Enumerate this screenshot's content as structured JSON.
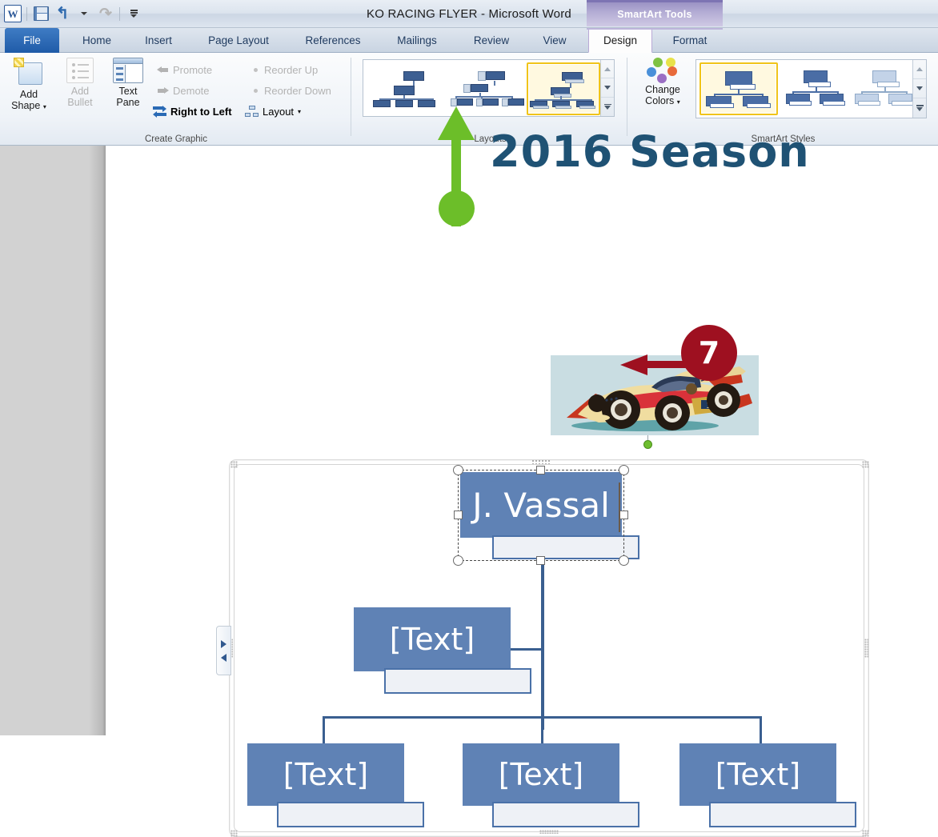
{
  "window": {
    "title": "KO RACING FLYER  -  Microsoft Word",
    "contextual_tab_group": "SmartArt Tools"
  },
  "quick_access": [
    {
      "name": "word-logo",
      "label": "W"
    },
    {
      "name": "save-icon",
      "label": "Save"
    },
    {
      "name": "undo-icon",
      "label": "Undo"
    },
    {
      "name": "undo-dropdown",
      "label": "Undo options"
    },
    {
      "name": "redo-icon",
      "label": "Redo"
    },
    {
      "name": "customize-qat",
      "label": "Customize Quick Access Toolbar"
    }
  ],
  "tabs": [
    {
      "label": "File",
      "state": "file"
    },
    {
      "label": "Home",
      "state": "normal"
    },
    {
      "label": "Insert",
      "state": "normal"
    },
    {
      "label": "Page Layout",
      "state": "normal"
    },
    {
      "label": "References",
      "state": "normal"
    },
    {
      "label": "Mailings",
      "state": "normal"
    },
    {
      "label": "Review",
      "state": "normal"
    },
    {
      "label": "View",
      "state": "normal"
    },
    {
      "label": "Design",
      "state": "active"
    },
    {
      "label": "Format",
      "state": "normal"
    }
  ],
  "ribbon": {
    "groups": [
      {
        "name": "create-graphic",
        "label": "Create Graphic"
      },
      {
        "name": "layouts",
        "label": "Layouts"
      },
      {
        "name": "smartart-styles",
        "label": "SmartArt Styles"
      }
    ],
    "create_graphic": {
      "add_shape": "Add\nShape",
      "add_shape_line1": "Add",
      "add_shape_line2": "Shape",
      "add_bullet_line1": "Add",
      "add_bullet_line2": "Bullet",
      "text_pane_line1": "Text",
      "text_pane_line2": "Pane",
      "promote": "Promote",
      "demote": "Demote",
      "right_to_left": "Right to Left",
      "reorder_up": "Reorder Up",
      "reorder_down": "Reorder Down",
      "layout": "Layout"
    },
    "styles": {
      "change_colors_line1": "Change",
      "change_colors_line2": "Colors"
    }
  },
  "document": {
    "flyer_title": "2016 Season",
    "smartart": {
      "top_node_text": "J. Vassal",
      "child_text": "[Text]",
      "nodes": [
        {
          "level": 1,
          "text": "J. Vassal",
          "selected": true
        },
        {
          "level": 2,
          "text": "[Text]",
          "selected": false
        },
        {
          "level": 3,
          "text": "[Text]",
          "selected": false
        },
        {
          "level": 3,
          "text": "[Text]",
          "selected": false
        },
        {
          "level": 3,
          "text": "[Text]",
          "selected": false
        }
      ]
    }
  },
  "callouts": [
    {
      "name": "green-arrow-callout",
      "points_to": "Layouts gallery"
    },
    {
      "name": "step-number-callout",
      "label": "7",
      "points_to": "J. Vassal node"
    }
  ],
  "colors": {
    "node_fill": "#5f82b5",
    "callout_red": "#9e1020",
    "callout_green": "#6cbe29",
    "gallery_selection": "#f0c419",
    "title_blue": "#1f5274"
  }
}
